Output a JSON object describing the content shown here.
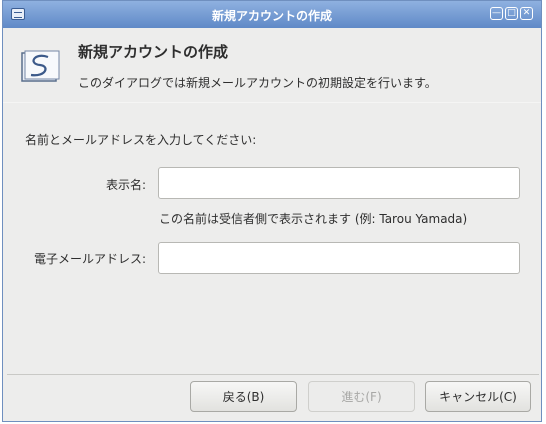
{
  "window": {
    "title": "新規アカウントの作成"
  },
  "header": {
    "title": "新規アカウントの作成",
    "subtitle": "このダイアログでは新規メールアカウントの初期設定を行います。",
    "icon": "mail-account-icon"
  },
  "form": {
    "prompt": "名前とメールアドレスを入力してください:",
    "display_name_label": "表示名:",
    "display_name_value": "",
    "display_name_hint": "この名前は受信者側で表示されます (例: Tarou Yamada)",
    "email_label": "電子メールアドレス:",
    "email_value": ""
  },
  "buttons": {
    "back": "戻る(B)",
    "next": "進む(F)",
    "cancel": "キャンセル(C)"
  },
  "colors": {
    "titlebar": "#5f89c7",
    "window_bg": "#ededec"
  }
}
